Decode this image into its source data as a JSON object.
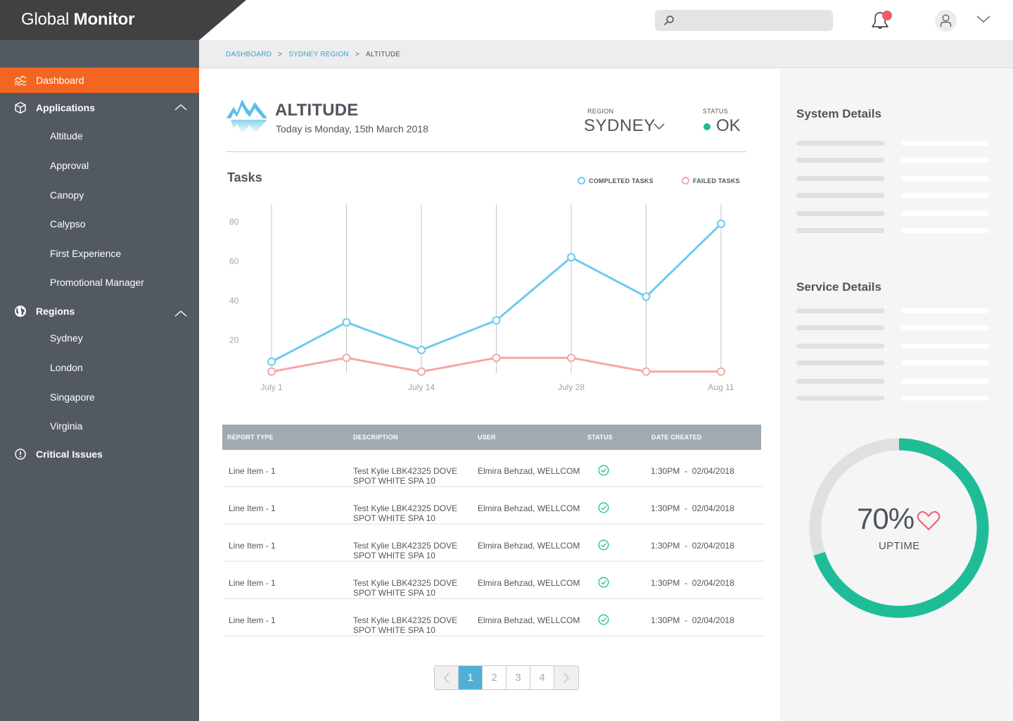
{
  "app": {
    "brand_light": "Global",
    "brand_bold": "Monitor"
  },
  "topbar": {
    "search_placeholder": "",
    "search_value": "",
    "notification_badge": true,
    "icons": [
      "search-icon",
      "bell-icon",
      "user-icon",
      "chevron-down-icon"
    ]
  },
  "sidebar": {
    "items": [
      {
        "label": "Dashboard",
        "icon": "activity-chart-icon",
        "active": true
      },
      {
        "label": "Applications",
        "icon": "cube-icon",
        "expanded": true,
        "children": [
          "Altitude",
          "Approval",
          "Canopy",
          "Calypso",
          "First Experience",
          "Promotional Manager"
        ]
      },
      {
        "label": "Regions",
        "icon": "globe-icon",
        "expanded": true,
        "children": [
          "Sydney",
          "London",
          "Singapore",
          "Virginia"
        ]
      },
      {
        "label": "Critical Issues",
        "icon": "alert-circle-icon"
      }
    ]
  },
  "breadcrumb": {
    "items": [
      "DASHBOARD",
      "SYDNEY REGION"
    ],
    "current": "ALTITUDE",
    "separator": ">"
  },
  "header": {
    "title": "ALTITUDE",
    "date_text": "Today is Monday, 15th March 2018",
    "region_label": "REGION",
    "region_value": "SYDNEY",
    "status_label": "STATUS",
    "status_value": "OK",
    "status_color": "#1ebd98"
  },
  "tasks": {
    "title": "Tasks",
    "legend": [
      {
        "label": "COMPLETED TASKS",
        "color": "#6ccbee"
      },
      {
        "label": "FAILED TASKS",
        "color": "#f4a7a7"
      }
    ]
  },
  "chart_data": {
    "type": "line",
    "title": "Tasks",
    "xlabel": "",
    "ylabel": "",
    "x_points": 7,
    "x_tick_labels": [
      {
        "index": 0,
        "label": "July 1"
      },
      {
        "index": 2,
        "label": "July 14"
      },
      {
        "index": 4,
        "label": "July 28"
      },
      {
        "index": 6,
        "label": "Aug 11"
      }
    ],
    "y_ticks": [
      20,
      40,
      60,
      80
    ],
    "ylim": [
      0,
      90
    ],
    "grid": "vertical",
    "legend_position": "top-right",
    "series": [
      {
        "name": "COMPLETED TASKS",
        "color": "#6ccbee",
        "values": [
          9,
          29,
          15,
          30,
          62,
          42,
          79
        ]
      },
      {
        "name": "FAILED TASKS",
        "color": "#f4a7a7",
        "values": [
          4,
          11,
          4,
          11,
          11,
          4,
          4
        ]
      }
    ]
  },
  "table": {
    "columns": [
      "REPORT TYPE",
      "DESCRIPTION",
      "USER",
      "STATUS",
      "DATE CREATED"
    ],
    "rows": [
      {
        "type": "Line Item - 1",
        "description": "Test Kylie LBK42325 DOVE SPOT WHITE SPA 10",
        "user": "Elmira Behzad, WELLCOM",
        "status": "check-circle-icon",
        "date": "1:30PM  -  02/04/2018"
      },
      {
        "type": "Line Item - 1",
        "description": "Test Kylie LBK42325 DOVE SPOT WHITE SPA 10",
        "user": "Elmira Behzad, WELLCOM",
        "status": "check-circle-icon",
        "date": "1:30PM  -  02/04/2018"
      },
      {
        "type": "Line Item - 1",
        "description": "Test Kylie LBK42325 DOVE SPOT WHITE SPA 10",
        "user": "Elmira Behzad, WELLCOM",
        "status": "check-circle-icon",
        "date": "1:30PM  -  02/04/2018"
      },
      {
        "type": "Line Item - 1",
        "description": "Test Kylie LBK42325 DOVE SPOT WHITE SPA 10",
        "user": "Elmira Behzad, WELLCOM",
        "status": "check-circle-icon",
        "date": "1:30PM  -  02/04/2018"
      },
      {
        "type": "Line Item - 1",
        "description": "Test Kylie LBK42325 DOVE SPOT WHITE SPA 10",
        "user": "Elmira Behzad, WELLCOM",
        "status": "check-circle-icon",
        "date": "1:30PM  -  02/04/2018"
      }
    ]
  },
  "pagination": {
    "pages": [
      "1",
      "2",
      "3",
      "4"
    ],
    "current": "1",
    "prev": "‹",
    "next": "›"
  },
  "right_panel": {
    "system_title": "System Details",
    "service_title": "Service Details",
    "skeleton_rows": 6,
    "uptime": {
      "value_text": "70%",
      "label": "UPTIME",
      "percent": 70,
      "color": "#1ebd98",
      "track_color": "#e0e0e0",
      "heart_color": "#ee5a6f"
    }
  },
  "colors": {
    "accent": "#f26622",
    "sidebar": "#535961",
    "brand_bar": "#414141",
    "link": "#3ba0d6",
    "pager_active": "#4eb0d6"
  }
}
